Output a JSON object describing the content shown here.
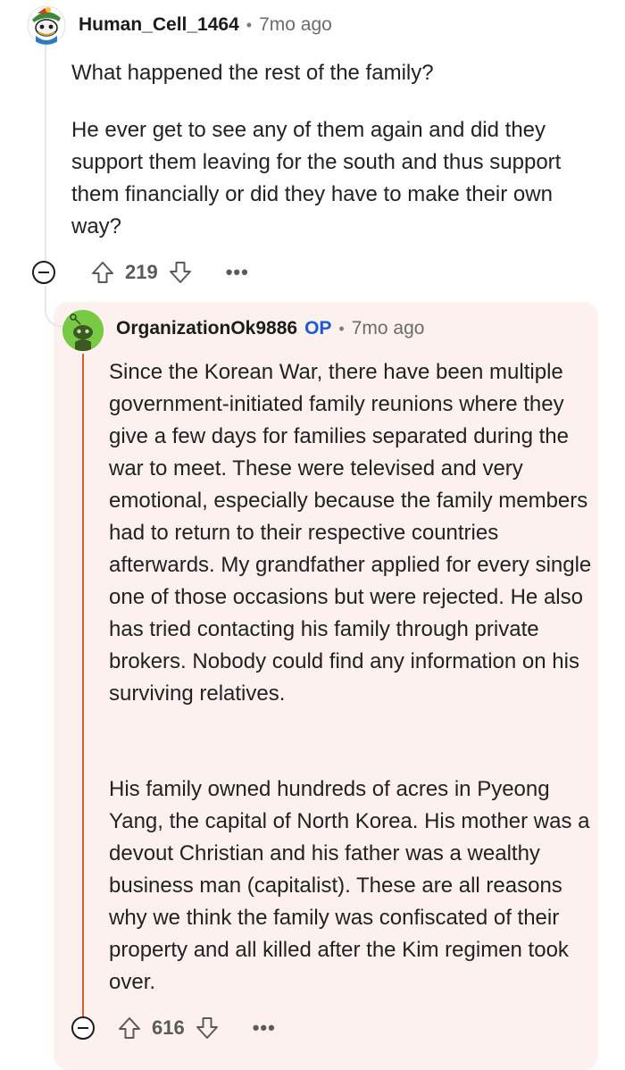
{
  "comments": [
    {
      "author": "Human_Cell_1464",
      "time": "7mo ago",
      "body": [
        "What happened the rest of the family?",
        "He ever get to see any of them again and did they support them leaving for the south and thus support them financially or did they have to make their own way?"
      ],
      "score": "219",
      "more": "•••"
    },
    {
      "author": "OrganizationOk9886",
      "op_badge": "OP",
      "time": "7mo ago",
      "body": [
        "Since the Korean War, there have been multiple government-initiated family reunions where they give a few days for families separated during the war to meet. These were televised and very emotional, especially because the family members had to return to their respective countries afterwards. My grandfather applied for every single one of those occasions but were rejected. He also has tried contacting his family through private brokers. Nobody could find any information on his surviving relatives.",
        "His family owned hundreds of acres in Pyeong Yang, the capital of North Korea. His mother was a devout Christian and his father was a wealthy business man (capitalist). These are all reasons why we think the family was confiscated of their property and all killed after the Kim regimen took over."
      ],
      "score": "616",
      "more": "•••"
    }
  ],
  "separator": "•",
  "colors": {
    "op_badge": "#1a5cd8",
    "thread_highlight": "#e35b2d",
    "reply_background": "#fdf1ef",
    "avatar_2": "#78c943"
  },
  "icons": [
    "snoo-avatar-icon",
    "snoo-green-avatar-icon",
    "collapse-icon",
    "upvote-icon",
    "downvote-icon",
    "more-options-icon"
  ]
}
